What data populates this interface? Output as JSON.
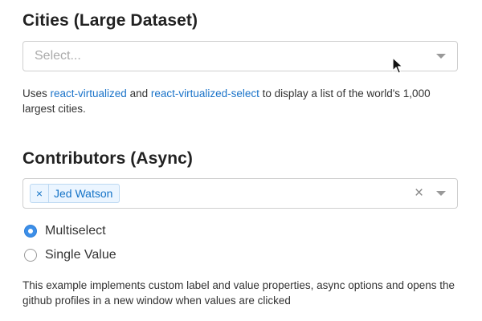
{
  "cities": {
    "title": "Cities (Large Dataset)",
    "select": {
      "placeholder": "Select...",
      "arrow_icon": "chevron-down-icon"
    },
    "help": {
      "prefix": "Uses ",
      "link1": "react-virtualized",
      "middle": " and ",
      "link2": "react-virtualized-select",
      "suffix": " to display a list of the world's 1,000 largest cities."
    }
  },
  "contributors": {
    "title": "Contributors (Async)",
    "select": {
      "selected_tags": [
        {
          "label": "Jed Watson",
          "remove_glyph": "×"
        }
      ],
      "clear_glyph": "×",
      "arrow_icon": "chevron-down-icon"
    },
    "mode_options": [
      {
        "label": "Multiselect",
        "checked": true
      },
      {
        "label": "Single Value",
        "checked": false
      }
    ],
    "help": "This example implements custom label and value properties, async options and opens the github profiles in a new window when values are clicked"
  },
  "colors": {
    "accent": "#3d8fe8",
    "link": "#1a73c9",
    "tag_background": "#ebf5ff",
    "tag_text": "#1473c7",
    "border": "#cfcfcf",
    "placeholder": "#aaaaaa"
  }
}
